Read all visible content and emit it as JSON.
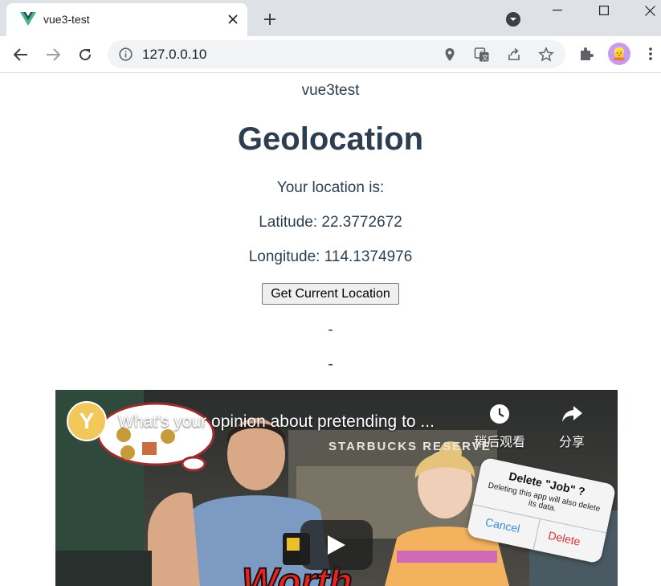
{
  "browser": {
    "tab_title": "vue3-test",
    "url": "127.0.0.10",
    "avatar_label": "👱"
  },
  "page": {
    "app_name": "vue3test",
    "title": "Geolocation",
    "location_label": "Your location is:",
    "latitude_text": "Latitude: 22.3772672",
    "longitude_text": "Longitude: 114.1374976",
    "button_label": "Get Current Location",
    "placeholder_1": "-",
    "placeholder_2": "-"
  },
  "video": {
    "channel_logo_letter": "Y",
    "title": "What's your opinion about pretending to ...",
    "watch_later_label": "稍后观看",
    "share_label": "分享",
    "store_sign": "STARBUCKS RESERVE",
    "dialog_title": "Delete \"Job\" ?",
    "dialog_message": "Deleting this app will also delete its data.",
    "dialog_cancel": "Cancel",
    "dialog_delete": "Delete",
    "overlay_text": "Worth"
  },
  "colors": {
    "text": "#2c3e50",
    "tabbar": "#dee1e6",
    "omnibox": "#f1f3f4",
    "vue_green": "#41b883",
    "vue_dark": "#35495e"
  }
}
